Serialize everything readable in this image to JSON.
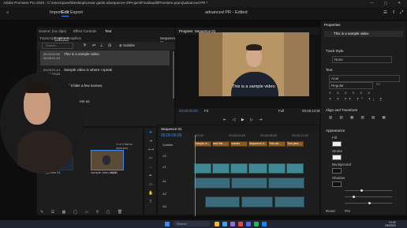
{
  "app": {
    "window_title": "Adobe Premiere Pro 2023 - C:\\Users\\pavel\\Desktop\\Linear gatits ai\\sequence-2\\Project\\Final\\audit\\Premiere.prproj\\advanced PR *",
    "window_controls": "— ▢ ✕"
  },
  "workspace": {
    "tabs": [
      "Import",
      "Edit",
      "Export"
    ],
    "active_tab": "Edit",
    "project_title": "advanced PR - Edited"
  },
  "left_panel": {
    "tabs": [
      "Source: (no clips)",
      "Effect Controls",
      "Text"
    ],
    "sub_tabs": [
      "Transcript",
      "Captions",
      "Graphics"
    ],
    "active_sub_tab": "Captions",
    "sequence_label": "Sequence 01",
    "search_placeholder": "Search",
    "subtitle_button": "Subtitle",
    "captions": [
      {
        "in": "00;00;00;00",
        "out": "00;00;01;14",
        "text": "This is a sample video."
      },
      {
        "in": "00;00;01;14",
        "out": "00;00;03;24",
        "text": "Sample video is where I speak"
      },
      {
        "in": "00;00;03;24",
        "out": "00;00;05;10",
        "text": "and it fake a few scenes."
      },
      {
        "in": "00;00;05;10",
        "out": "00;00;07;02",
        "text": "…tugle seem so"
      },
      {
        "in": "00;00;07;02",
        "out": "00;00;08;20",
        "text": "…cated files"
      }
    ]
  },
  "program_monitor": {
    "tab_label": "Program: Sequence 01",
    "caption_overlay": "This is a sample video.",
    "timecode": "00;00;00;00",
    "fit": "Fit",
    "quality": "Full",
    "duration": "00;00;10;00"
  },
  "project_panel": {
    "items_selected": "1 of 2 items selected",
    "clips": [
      {
        "name": "Sequence 01",
        "duration": ""
      },
      {
        "name": "sample video.mp4",
        "duration": "10;00"
      }
    ]
  },
  "timeline": {
    "tab_label": "Sequence 01",
    "timecode": "00;00;00;00",
    "track_labels": [
      "Subtitle",
      "V2",
      "V1",
      "A1",
      "A2",
      "A3"
    ],
    "caption_clips": [
      "Sample vi…",
      "and this…",
      "scenes",
      "Sequence 0…",
      "This vid…",
      "This plea…"
    ],
    "ruler_marks": [
      "00;00",
      "00;00;04;00",
      "00;00;08;00",
      "00;00;12;00"
    ]
  },
  "essential_graphics": {
    "title": "Properties",
    "header_name": "This is a sample video",
    "sections": {
      "track_style": "Track Style",
      "track_style_value": "None",
      "text": "Text",
      "font": "Arial",
      "font_style": "Regular",
      "font_size": "62",
      "align_transform": "Align and Transform",
      "appearance": "Appearance",
      "fill": "Fill",
      "stroke": "Stroke",
      "background": "Background",
      "shadow": "Shadow",
      "subtitle_labels": [
        "Reset",
        "Pre"
      ]
    }
  },
  "taskbar": {
    "search_placeholder": "Search",
    "time": "14:40",
    "date": "2/8/2023"
  },
  "colors": {
    "accent": "#3d8af7",
    "video_clip": "#3f8894",
    "audio_clip": "#3b6a7a",
    "caption_clip": "#8a5a20",
    "playhead": "#4a8cff"
  }
}
